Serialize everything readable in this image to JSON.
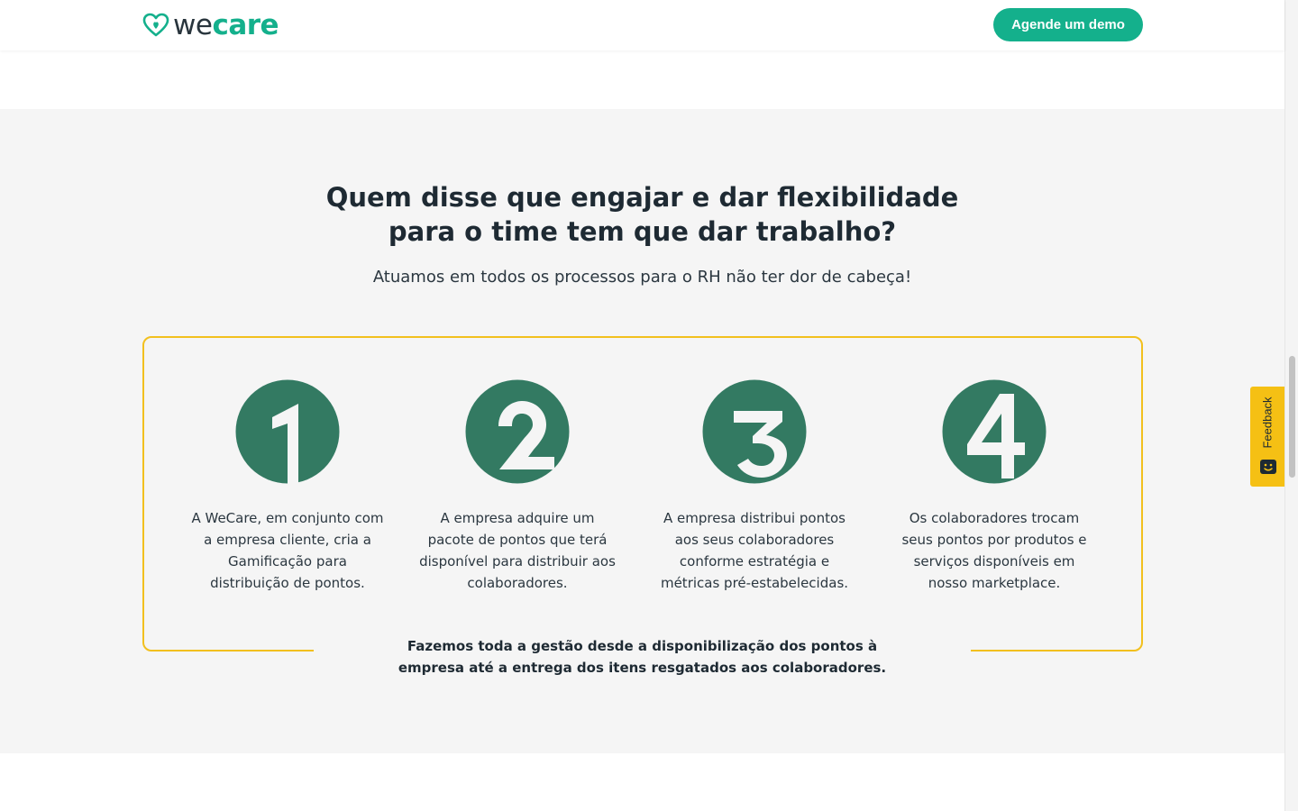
{
  "header": {
    "logo": {
      "part1": "we",
      "part2": "care",
      "icon": "heart-logo-icon"
    },
    "cta_label": "Agende um demo"
  },
  "section": {
    "title_line1": "Quem disse que engajar e dar flexibilidade",
    "title_line2": "para o time tem que dar trabalho?",
    "subtitle": "Atuamos em todos os processos para o RH não ter dor de cabeça!",
    "steps": [
      {
        "number": "1",
        "icon": "number-1-icon",
        "text": "A WeCare, em conjunto com a empresa cliente, cria a Gamificação para distribuição de pontos."
      },
      {
        "number": "2",
        "icon": "number-2-icon",
        "text": "A empresa adquire um pacote de pontos que terá disponível para distribuir aos colaboradores."
      },
      {
        "number": "3",
        "icon": "number-3-icon",
        "text": "A empresa distribui pontos aos seus colaboradores conforme estratégia e métricas pré-estabelecidas."
      },
      {
        "number": "4",
        "icon": "number-4-icon",
        "text": "Os colaboradores trocam seus pontos por produtos e serviços disponíveis em nosso marketplace."
      }
    ],
    "footer_note": "Fazemos toda a gestão desde a disponibilização dos pontos à empresa até a entrega dos itens resgatados aos colaboradores."
  },
  "feedback": {
    "label": "Feedback",
    "icon": "smiley-icon"
  },
  "colors": {
    "brand_green": "#14b08c",
    "step_green": "#337a62",
    "frame_yellow": "#f2c01e",
    "feedback_yellow": "#f5c014",
    "text_dark": "#1e2a33",
    "section_bg": "#f5f5f5"
  }
}
